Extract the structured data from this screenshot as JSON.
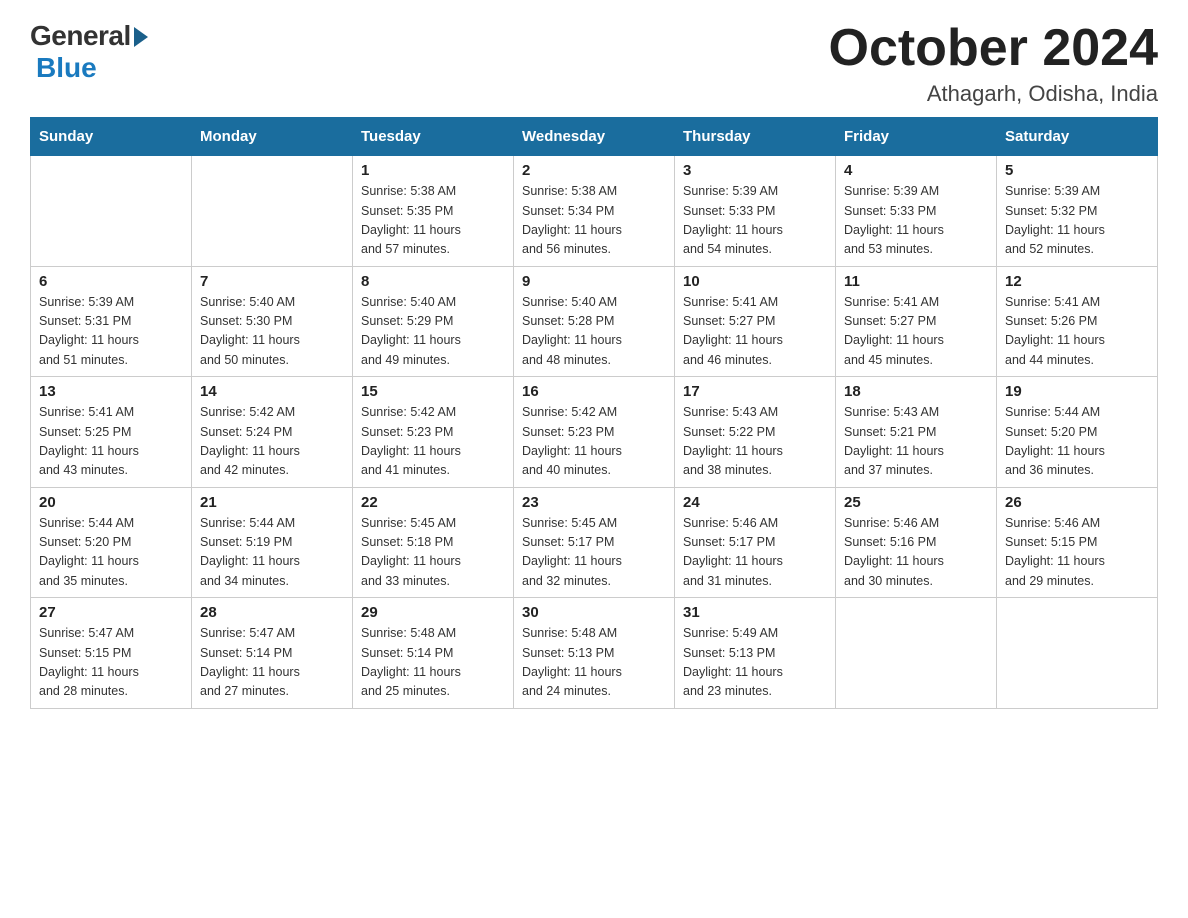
{
  "logo": {
    "general": "General",
    "blue": "Blue"
  },
  "title": "October 2024",
  "location": "Athagarh, Odisha, India",
  "days_header": [
    "Sunday",
    "Monday",
    "Tuesday",
    "Wednesday",
    "Thursday",
    "Friday",
    "Saturday"
  ],
  "weeks": [
    [
      {
        "day": "",
        "info": ""
      },
      {
        "day": "",
        "info": ""
      },
      {
        "day": "1",
        "info": "Sunrise: 5:38 AM\nSunset: 5:35 PM\nDaylight: 11 hours\nand 57 minutes."
      },
      {
        "day": "2",
        "info": "Sunrise: 5:38 AM\nSunset: 5:34 PM\nDaylight: 11 hours\nand 56 minutes."
      },
      {
        "day": "3",
        "info": "Sunrise: 5:39 AM\nSunset: 5:33 PM\nDaylight: 11 hours\nand 54 minutes."
      },
      {
        "day": "4",
        "info": "Sunrise: 5:39 AM\nSunset: 5:33 PM\nDaylight: 11 hours\nand 53 minutes."
      },
      {
        "day": "5",
        "info": "Sunrise: 5:39 AM\nSunset: 5:32 PM\nDaylight: 11 hours\nand 52 minutes."
      }
    ],
    [
      {
        "day": "6",
        "info": "Sunrise: 5:39 AM\nSunset: 5:31 PM\nDaylight: 11 hours\nand 51 minutes."
      },
      {
        "day": "7",
        "info": "Sunrise: 5:40 AM\nSunset: 5:30 PM\nDaylight: 11 hours\nand 50 minutes."
      },
      {
        "day": "8",
        "info": "Sunrise: 5:40 AM\nSunset: 5:29 PM\nDaylight: 11 hours\nand 49 minutes."
      },
      {
        "day": "9",
        "info": "Sunrise: 5:40 AM\nSunset: 5:28 PM\nDaylight: 11 hours\nand 48 minutes."
      },
      {
        "day": "10",
        "info": "Sunrise: 5:41 AM\nSunset: 5:27 PM\nDaylight: 11 hours\nand 46 minutes."
      },
      {
        "day": "11",
        "info": "Sunrise: 5:41 AM\nSunset: 5:27 PM\nDaylight: 11 hours\nand 45 minutes."
      },
      {
        "day": "12",
        "info": "Sunrise: 5:41 AM\nSunset: 5:26 PM\nDaylight: 11 hours\nand 44 minutes."
      }
    ],
    [
      {
        "day": "13",
        "info": "Sunrise: 5:41 AM\nSunset: 5:25 PM\nDaylight: 11 hours\nand 43 minutes."
      },
      {
        "day": "14",
        "info": "Sunrise: 5:42 AM\nSunset: 5:24 PM\nDaylight: 11 hours\nand 42 minutes."
      },
      {
        "day": "15",
        "info": "Sunrise: 5:42 AM\nSunset: 5:23 PM\nDaylight: 11 hours\nand 41 minutes."
      },
      {
        "day": "16",
        "info": "Sunrise: 5:42 AM\nSunset: 5:23 PM\nDaylight: 11 hours\nand 40 minutes."
      },
      {
        "day": "17",
        "info": "Sunrise: 5:43 AM\nSunset: 5:22 PM\nDaylight: 11 hours\nand 38 minutes."
      },
      {
        "day": "18",
        "info": "Sunrise: 5:43 AM\nSunset: 5:21 PM\nDaylight: 11 hours\nand 37 minutes."
      },
      {
        "day": "19",
        "info": "Sunrise: 5:44 AM\nSunset: 5:20 PM\nDaylight: 11 hours\nand 36 minutes."
      }
    ],
    [
      {
        "day": "20",
        "info": "Sunrise: 5:44 AM\nSunset: 5:20 PM\nDaylight: 11 hours\nand 35 minutes."
      },
      {
        "day": "21",
        "info": "Sunrise: 5:44 AM\nSunset: 5:19 PM\nDaylight: 11 hours\nand 34 minutes."
      },
      {
        "day": "22",
        "info": "Sunrise: 5:45 AM\nSunset: 5:18 PM\nDaylight: 11 hours\nand 33 minutes."
      },
      {
        "day": "23",
        "info": "Sunrise: 5:45 AM\nSunset: 5:17 PM\nDaylight: 11 hours\nand 32 minutes."
      },
      {
        "day": "24",
        "info": "Sunrise: 5:46 AM\nSunset: 5:17 PM\nDaylight: 11 hours\nand 31 minutes."
      },
      {
        "day": "25",
        "info": "Sunrise: 5:46 AM\nSunset: 5:16 PM\nDaylight: 11 hours\nand 30 minutes."
      },
      {
        "day": "26",
        "info": "Sunrise: 5:46 AM\nSunset: 5:15 PM\nDaylight: 11 hours\nand 29 minutes."
      }
    ],
    [
      {
        "day": "27",
        "info": "Sunrise: 5:47 AM\nSunset: 5:15 PM\nDaylight: 11 hours\nand 28 minutes."
      },
      {
        "day": "28",
        "info": "Sunrise: 5:47 AM\nSunset: 5:14 PM\nDaylight: 11 hours\nand 27 minutes."
      },
      {
        "day": "29",
        "info": "Sunrise: 5:48 AM\nSunset: 5:14 PM\nDaylight: 11 hours\nand 25 minutes."
      },
      {
        "day": "30",
        "info": "Sunrise: 5:48 AM\nSunset: 5:13 PM\nDaylight: 11 hours\nand 24 minutes."
      },
      {
        "day": "31",
        "info": "Sunrise: 5:49 AM\nSunset: 5:13 PM\nDaylight: 11 hours\nand 23 minutes."
      },
      {
        "day": "",
        "info": ""
      },
      {
        "day": "",
        "info": ""
      }
    ]
  ]
}
